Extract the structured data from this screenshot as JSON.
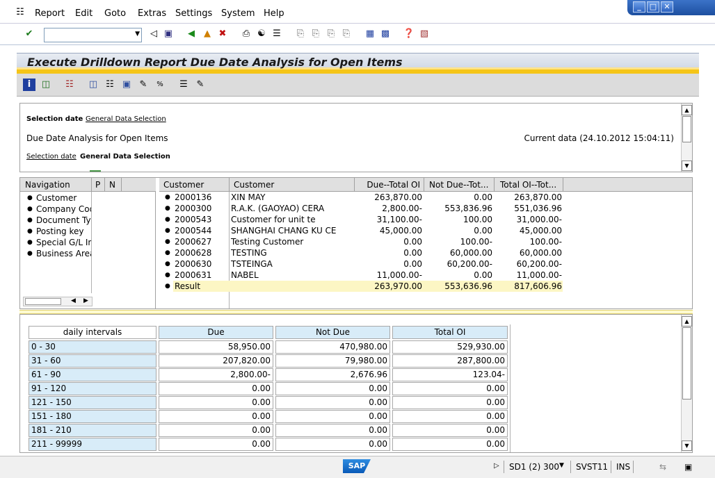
{
  "menu": {
    "items": [
      {
        "label": "Report",
        "u": "R"
      },
      {
        "label": "Edit",
        "u": "E"
      },
      {
        "label": "Goto",
        "u": "G"
      },
      {
        "label": "Extras",
        "u": "x"
      },
      {
        "label": "Settings",
        "u": "S"
      },
      {
        "label": "System",
        "u": "y"
      },
      {
        "label": "Help",
        "u": "H"
      }
    ]
  },
  "command_field": {
    "value": ""
  },
  "title": "Execute Drilldown Report Due Date Analysis for Open Items",
  "header": {
    "link_row1_bold": "Selection date",
    "link_row1_link": "General Data Selection",
    "report_name": "Due Date Analysis for Open Items",
    "current_data": "Current data (24.10.2012 15:04:11)",
    "link_row2_link": "Selection date",
    "link_row2_bold": "General Data Selection"
  },
  "navigation": {
    "headers": [
      "Navigation",
      "P",
      "N"
    ],
    "items": [
      "Customer",
      "Company Code",
      "Document Type",
      "Posting key",
      "Special G/L Ind",
      "Business Area"
    ]
  },
  "customer_table": {
    "headers": [
      "Customer",
      "Customer",
      "Due--Total OI",
      "Not Due--Tot...",
      "Total OI--Tot..."
    ],
    "rows": [
      {
        "id": "2000136",
        "name": "XIN MAY",
        "due": "263,870.00",
        "not_due": "0.00",
        "total": "263,870.00"
      },
      {
        "id": "2000300",
        "name": "R.A.K. (GAOYAO) CERA",
        "due": "2,800.00-",
        "not_due": "553,836.96",
        "total": "551,036.96"
      },
      {
        "id": "2000543",
        "name": "Customer for unit te",
        "due": "31,100.00-",
        "not_due": "100.00",
        "total": "31,000.00-"
      },
      {
        "id": "2000544",
        "name": "SHANGHAI CHANG KU CE",
        "due": "45,000.00",
        "not_due": "0.00",
        "total": "45,000.00"
      },
      {
        "id": "2000627",
        "name": "Testing Customer",
        "due": "0.00",
        "not_due": "100.00-",
        "total": "100.00-"
      },
      {
        "id": "2000628",
        "name": "TESTING",
        "due": "0.00",
        "not_due": "60,000.00",
        "total": "60,000.00"
      },
      {
        "id": "2000630",
        "name": "TSTEINGA",
        "due": "0.00",
        "not_due": "60,200.00-",
        "total": "60,200.00-"
      },
      {
        "id": "2000631",
        "name": "NABEL",
        "due": "11,000.00-",
        "not_due": "0.00",
        "total": "11,000.00-"
      }
    ],
    "result": {
      "label": "Result",
      "due": "263,970.00",
      "not_due": "553,636.96",
      "total": "817,606.96"
    }
  },
  "intervals_table": {
    "headers": [
      "daily intervals",
      "Due",
      "Not Due",
      "Total OI"
    ],
    "rows": [
      {
        "label": "0 - 30",
        "due": "58,950.00",
        "not_due": "470,980.00",
        "total": "529,930.00"
      },
      {
        "label": "31 - 60",
        "due": "207,820.00",
        "not_due": "79,980.00",
        "total": "287,800.00"
      },
      {
        "label": "61 - 90",
        "due": "2,800.00-",
        "not_due": "2,676.96",
        "total": "123.04-"
      },
      {
        "label": "91 - 120",
        "due": "0.00",
        "not_due": "0.00",
        "total": "0.00"
      },
      {
        "label": "121 - 150",
        "due": "0.00",
        "not_due": "0.00",
        "total": "0.00"
      },
      {
        "label": "151 - 180",
        "due": "0.00",
        "not_due": "0.00",
        "total": "0.00"
      },
      {
        "label": "181 - 210",
        "due": "0.00",
        "not_due": "0.00",
        "total": "0.00"
      },
      {
        "label": "211 - 99999",
        "due": "0.00",
        "not_due": "0.00",
        "total": "0.00"
      }
    ]
  },
  "status": {
    "logo": "SAP",
    "system": "SD1 (2) 300",
    "server": "SVST11",
    "mode": "INS"
  },
  "colors": {
    "accent_yellow": "#f5c518",
    "cell_blue": "#d8ecf8",
    "result_bg": "#fcf6c4"
  }
}
